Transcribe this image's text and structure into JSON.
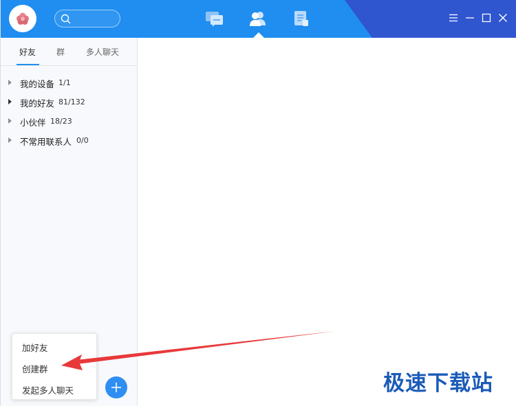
{
  "header": {
    "icons": [
      "avatar-flower-icon",
      "search-icon",
      "message-icon",
      "contacts-icon",
      "space-icon",
      "menu-icon",
      "minimize-icon",
      "maximize-icon",
      "close-icon"
    ],
    "colors": {
      "bar": "#1f8ef0",
      "bar_dark": "#2f55cf"
    }
  },
  "sidebar": {
    "tabs": [
      {
        "label": "好友",
        "active": true
      },
      {
        "label": "群",
        "active": false
      },
      {
        "label": "多人聊天",
        "active": false
      }
    ],
    "groups": [
      {
        "name": "我的设备",
        "count": "1/1"
      },
      {
        "name": "我的好友",
        "count": "81/132"
      },
      {
        "name": "小伙伴",
        "count": "18/23"
      },
      {
        "name": "不常用联系人",
        "count": "0/0"
      }
    ]
  },
  "popup_menu": {
    "items": [
      {
        "label": "加好友"
      },
      {
        "label": "创建群"
      },
      {
        "label": "发起多人聊天"
      }
    ]
  },
  "add_button": {
    "icon": "plus-icon",
    "color": "#2e8ef2"
  },
  "annotation": {
    "arrow_color": "#e8393a"
  },
  "watermark": {
    "text": "极速下载站",
    "color": "#1b5bb8"
  }
}
